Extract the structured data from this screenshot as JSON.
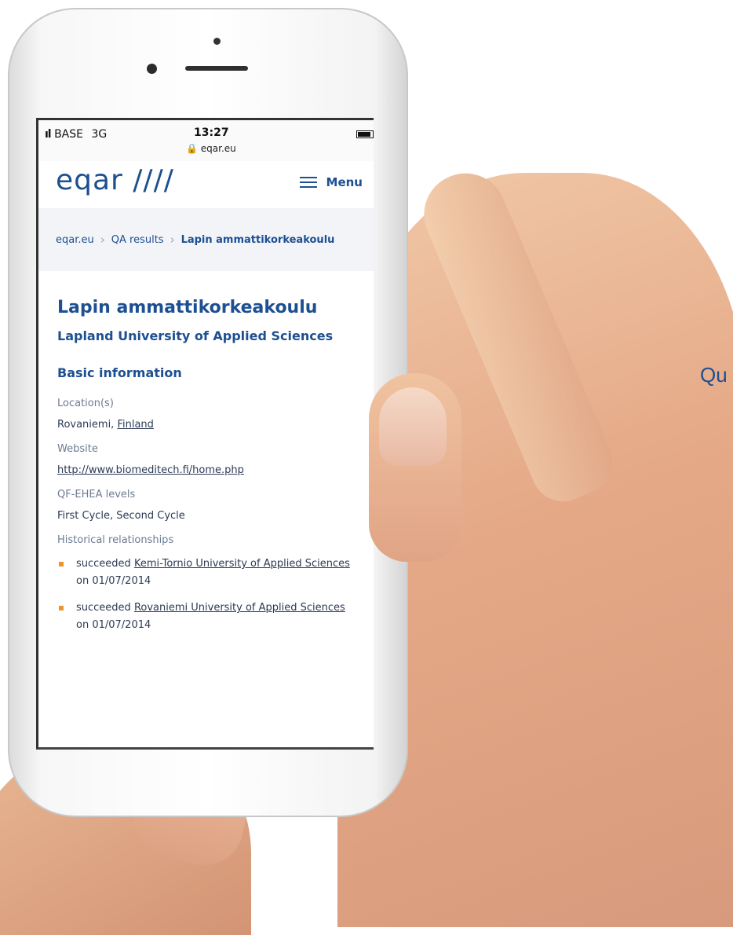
{
  "status_bar": {
    "carrier": "BASE",
    "network": "3G",
    "time": "13:27",
    "url": "eqar.eu"
  },
  "header": {
    "logo_text": "eqar ////",
    "menu_label": "Menu"
  },
  "breadcrumb": {
    "items": [
      "eqar.eu",
      "QA results",
      "Lapin ammattikorkeakoulu"
    ]
  },
  "page": {
    "title": "Lapin ammattikorkeakoulu",
    "subtitle": "Lapland University of Applied Sciences",
    "section_title": "Basic information",
    "location_label": "Location(s)",
    "location_city": "Rovaniemi, ",
    "location_country": "Finland",
    "website_label": "Website",
    "website_url": "http://www.biomeditech.fi/home.php",
    "qf_label": "QF-EHEA levels",
    "qf_value": "First Cycle, Second Cycle",
    "historical_label": "Historical relationships",
    "historical": [
      {
        "prefix": "succeeded ",
        "link": "Kemi-Tornio University of Applied Sciences",
        "suffix": " on 01/07/2014"
      },
      {
        "prefix": "succeeded ",
        "link": "Rovaniemi University of Applied Sciences",
        "suffix": " on 01/07/2014"
      }
    ]
  },
  "side_text": "Qu",
  "colors": {
    "brand": "#1d4f91",
    "bullet": "#f0922e",
    "breadcrumb_bg": "#f2f4f8"
  }
}
